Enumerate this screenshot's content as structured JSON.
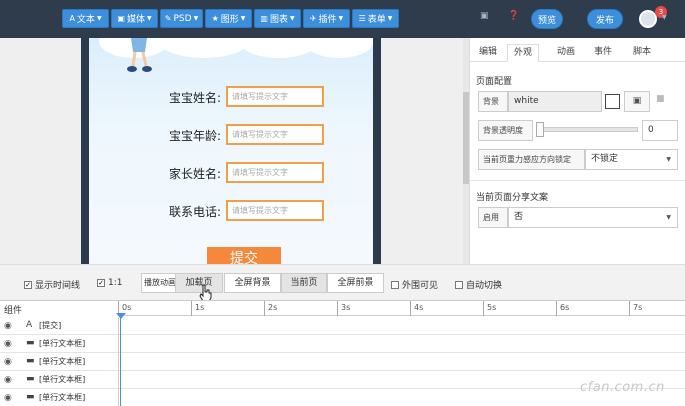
{
  "toolbar": {
    "buttons": [
      {
        "label": "文本",
        "icon": "text-icon",
        "glyph": "A"
      },
      {
        "label": "媒体",
        "icon": "image-icon",
        "glyph": "▣"
      },
      {
        "label": "PSD",
        "icon": "psd-icon",
        "glyph": "✎"
      },
      {
        "label": "图形",
        "icon": "star-icon",
        "glyph": "★"
      },
      {
        "label": "图表",
        "icon": "chart-icon",
        "glyph": "▥"
      },
      {
        "label": "插件",
        "icon": "plugin-icon",
        "glyph": "✈"
      },
      {
        "label": "表单",
        "icon": "form-icon",
        "glyph": "☰"
      }
    ],
    "preview_label": "预览",
    "publish_label": "发布",
    "notification_count": "3"
  },
  "phone_form": {
    "fields": [
      {
        "label": "宝宝姓名:",
        "placeholder": "请填写提示文字"
      },
      {
        "label": "宝宝年龄:",
        "placeholder": "请填写提示文字"
      },
      {
        "label": "家长姓名:",
        "placeholder": "请填写提示文字"
      },
      {
        "label": "联系电话:",
        "placeholder": "请填写提示文字"
      }
    ],
    "submit_label": "提交"
  },
  "panel": {
    "tabs": [
      "编辑",
      "外观",
      "动画",
      "事件",
      "脚本"
    ],
    "active_tab": "外观",
    "page_config_title": "页面配置",
    "background_label": "背景",
    "background_value": "white",
    "bg_opacity_label": "背景透明度",
    "bg_opacity_value": "0",
    "gravity_label": "当前页重力感应方向锁定",
    "gravity_value": "不锁定",
    "share_title": "当前页面分享文案",
    "share_enable_label": "启用",
    "share_enable_value": "否"
  },
  "controls": {
    "show_timeline_label": "显示时间线",
    "ratio_label": "1:1",
    "play_anim_label": "播放动画",
    "seg_buttons": [
      "加载页",
      "全屏背景",
      "当前页",
      "全屏前景"
    ],
    "outside_visible_label": "外围可见",
    "auto_switch_label": "自动切换"
  },
  "timeline": {
    "column_label": "组件",
    "ticks": [
      "0s",
      "1s",
      "2s",
      "3s",
      "4s",
      "5s",
      "6s",
      "7s"
    ],
    "layers": [
      {
        "icon": "text-icon",
        "glyph": "A",
        "name": "[提交]"
      },
      {
        "icon": "file-icon",
        "glyph": "▬",
        "name": "[单行文本框]"
      },
      {
        "icon": "file-icon",
        "glyph": "▬",
        "name": "[单行文本框]"
      },
      {
        "icon": "file-icon",
        "glyph": "▬",
        "name": "[单行文本框]"
      },
      {
        "icon": "file-icon",
        "glyph": "▬",
        "name": "[单行文本框]"
      }
    ]
  },
  "watermark": "cfan.com.cn",
  "colors": {
    "accent": "#3d8fdb",
    "toolbar_bg": "#2f3c4c",
    "input_border": "#f0a048",
    "submit_bg": "#f5883a"
  }
}
